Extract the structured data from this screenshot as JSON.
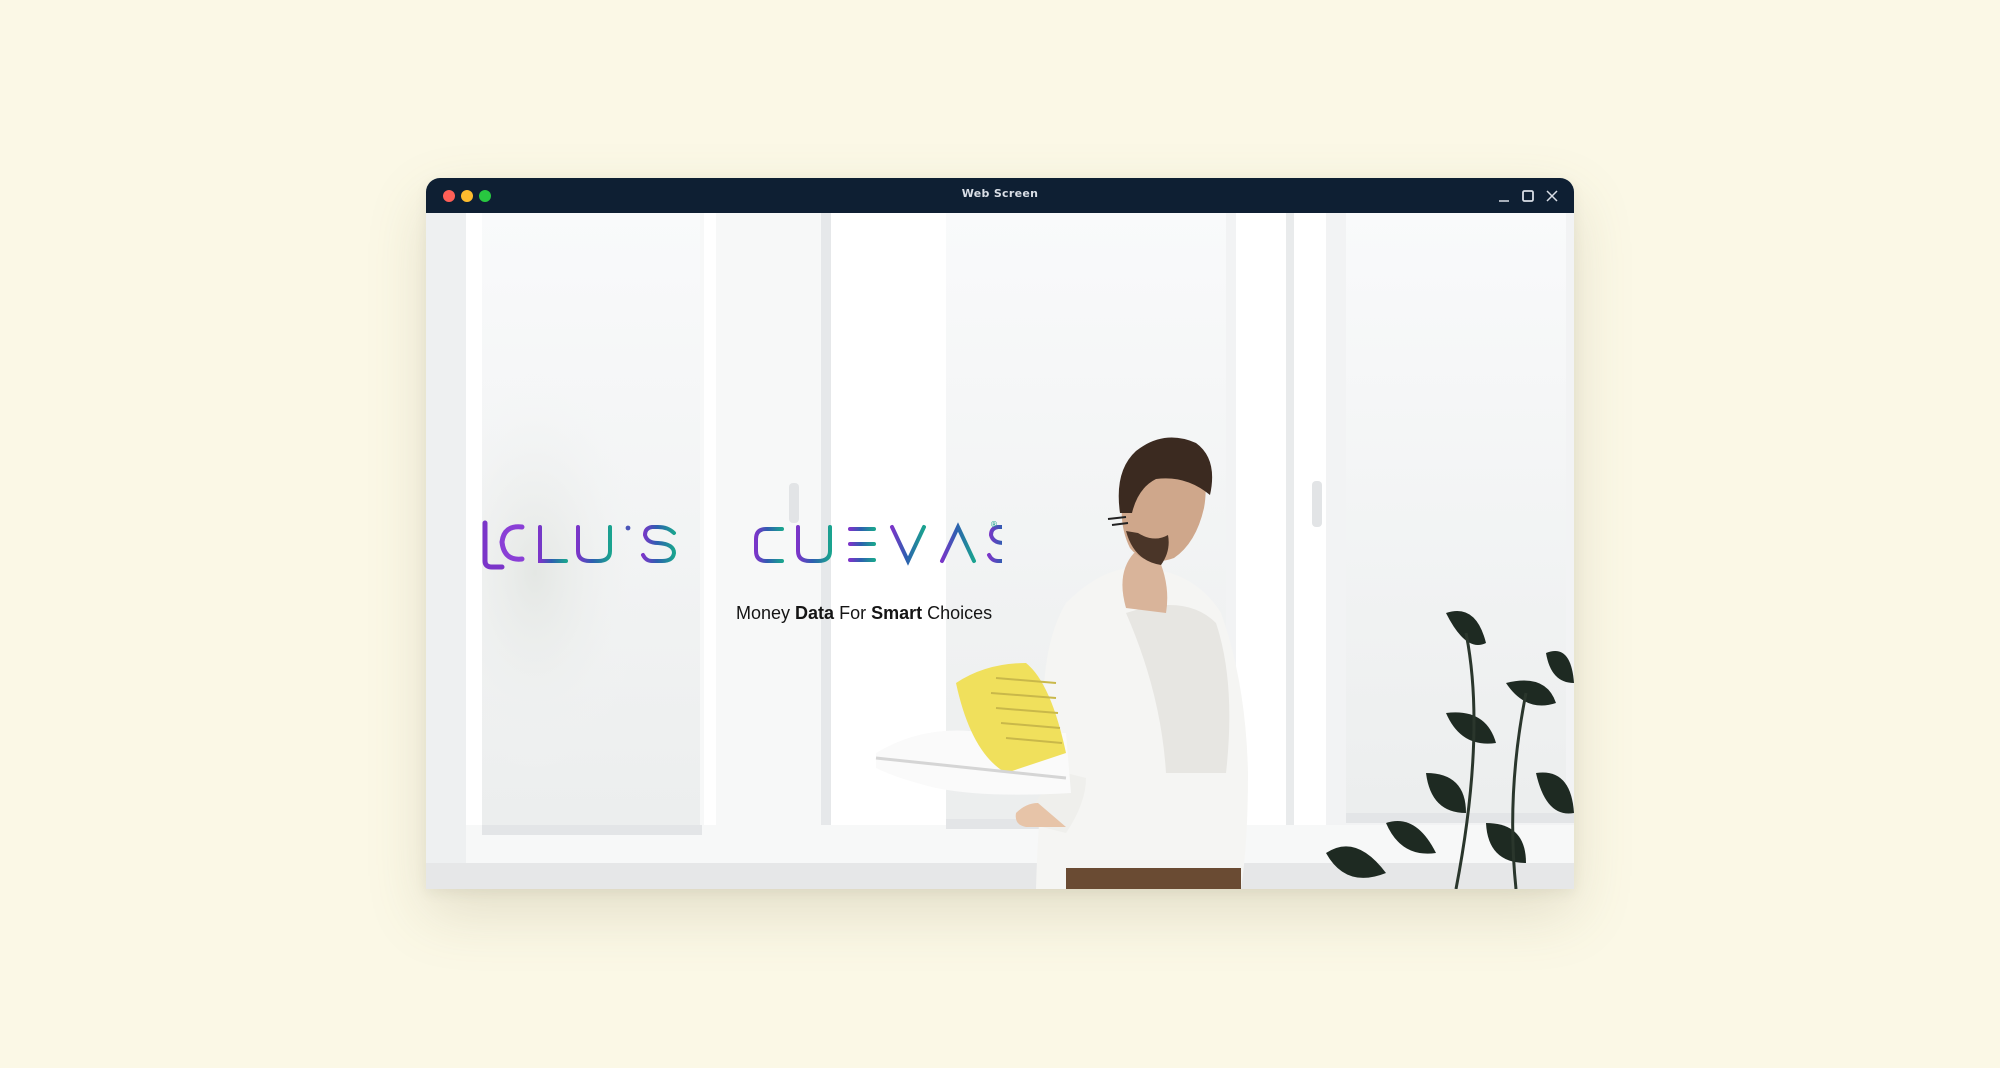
{
  "window": {
    "title": "Web Screen",
    "controls": {
      "minimize": "minimize",
      "maximize": "maximize",
      "close": "close"
    },
    "traffic_lights": {
      "close": "#ff5f57",
      "minimize": "#febc2e",
      "maximize": "#28c840"
    }
  },
  "hero": {
    "logo": {
      "mark": "LC",
      "word1": "LUIS",
      "word2": "CUEVAS",
      "trademark": "®"
    },
    "tagline": {
      "w1": "Money",
      "w2": "Data",
      "w3": "For",
      "w4": "Smart",
      "w5": "Choices"
    },
    "image_alt": "Man reading a yellow document by a bright window with a plant"
  },
  "colors": {
    "page_background": "#fbf8e6",
    "titlebar": "#0e1f33",
    "logo_purple": "#7b35c9",
    "logo_teal": "#1aa38f",
    "logo_blue": "#2d5fb0"
  }
}
